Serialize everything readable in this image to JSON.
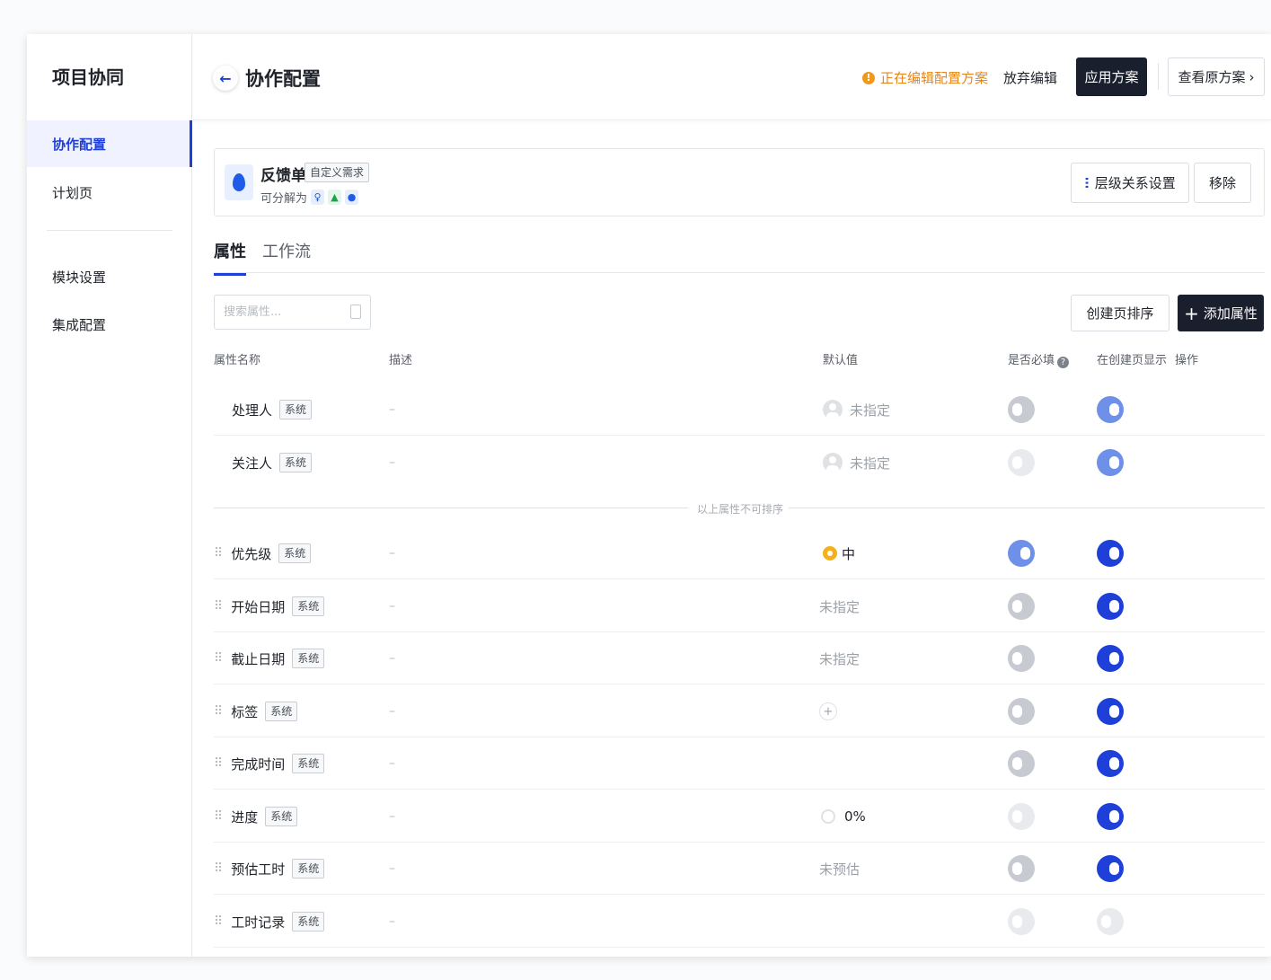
{
  "sidebar": {
    "title": "项目协同",
    "items": [
      {
        "label": "协作配置",
        "active": true
      },
      {
        "label": "计划页",
        "active": false
      },
      {
        "label": "模块设置",
        "active": false
      },
      {
        "label": "集成配置",
        "active": false
      }
    ]
  },
  "header": {
    "title": "协作配置",
    "editing_status": "正在编辑配置方案",
    "discard_label": "放弃编辑",
    "apply_label": "应用方案",
    "view_original_label": "查看原方案"
  },
  "card": {
    "name": "反馈单",
    "type_tag": "自定义需求",
    "decomposable_label": "可分解为",
    "hierarchy_button": "层级关系设置",
    "remove_button": "移除"
  },
  "tabs": [
    {
      "label": "属性",
      "active": true
    },
    {
      "label": "工作流",
      "active": false
    }
  ],
  "search": {
    "placeholder": "搜索属性..."
  },
  "toolbar": {
    "sort_label": "创建页排序",
    "add_label": "添加属性"
  },
  "table": {
    "columns": {
      "name": "属性名称",
      "desc": "描述",
      "default": "默认值",
      "required": "是否必填",
      "show_on_create": "在创建页显示",
      "actions": "操作"
    },
    "system_tag": "系统",
    "empty_desc": "–",
    "divider_text": "以上属性不可排序",
    "fixed_rows": [
      {
        "name": "处理人",
        "default": "未指定",
        "required": "off",
        "show": "on-dis"
      },
      {
        "name": "关注人",
        "default": "未指定",
        "required": "off-dis",
        "show": "on-dis"
      }
    ],
    "rows": [
      {
        "name": "优先级",
        "default": "中",
        "required": "on-dis",
        "show": "on"
      },
      {
        "name": "开始日期",
        "default": "未指定",
        "required": "off",
        "show": "on"
      },
      {
        "name": "截止日期",
        "default": "未指定",
        "required": "off",
        "show": "on"
      },
      {
        "name": "标签",
        "default": "+",
        "required": "off",
        "show": "on"
      },
      {
        "name": "完成时间",
        "default": "",
        "required": "off",
        "show": "on"
      },
      {
        "name": "进度",
        "default": "0%",
        "required": "off-dis",
        "show": "on"
      },
      {
        "name": "预估工时",
        "default": "未预估",
        "required": "off",
        "show": "on"
      },
      {
        "name": "工时记录",
        "default": "",
        "required": "off-dis",
        "show": "off-dis"
      }
    ]
  },
  "colors": {
    "accent": "#1e3fd8",
    "dark_button": "#1a1f2e",
    "warning": "#e7861b",
    "priority_medium": "#f3b21c"
  }
}
